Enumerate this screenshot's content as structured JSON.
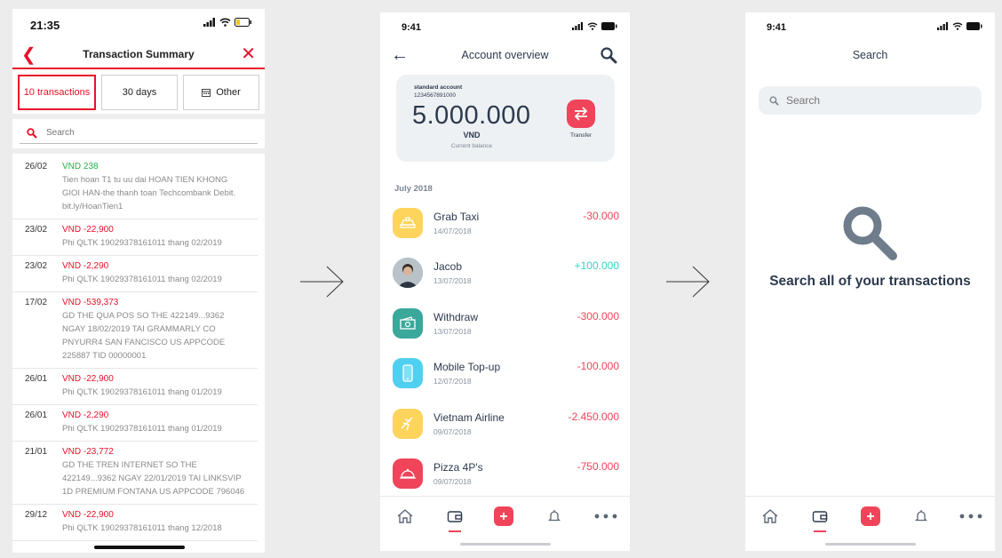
{
  "screen1": {
    "status_time": "21:35",
    "title": "Transaction Summary",
    "filters": [
      {
        "label": "10 transactions",
        "active": true
      },
      {
        "label": "30 days",
        "active": false
      },
      {
        "label": "Other",
        "active": false,
        "icon": "calendar-icon"
      }
    ],
    "search_placeholder": "Search",
    "transactions": [
      {
        "date": "26/02",
        "amount": "VND 238",
        "positive": true,
        "desc": [
          "Tien hoan T1 tu uu dai HOAN TIEN KHONG",
          "GIOI HAN-the thanh toan Techcombank Debit.",
          "bit.ly/HoanTien1"
        ]
      },
      {
        "date": "23/02",
        "amount": "VND -22,900",
        "positive": false,
        "desc": [
          "Phi QLTK 19029378161011 thang 02/2019"
        ]
      },
      {
        "date": "23/02",
        "amount": "VND -2,290",
        "positive": false,
        "desc": [
          "Phi QLTK 19029378161011 thang 02/2019"
        ]
      },
      {
        "date": "17/02",
        "amount": "VND -539,373",
        "positive": false,
        "desc": [
          "GD THE QUA POS SO THE 422149...9362",
          "NGAY 18/02/2019 TAI GRAMMARLY CO",
          "PNYURR4 SAN FANCISCO US APPCODE",
          "225887 TID 00000001"
        ]
      },
      {
        "date": "26/01",
        "amount": "VND -22,900",
        "positive": false,
        "desc": [
          "Phi QLTK 19029378161011 thang 01/2019"
        ]
      },
      {
        "date": "26/01",
        "amount": "VND -2,290",
        "positive": false,
        "desc": [
          "Phi QLTK 19029378161011 thang 01/2019"
        ]
      },
      {
        "date": "21/01",
        "amount": "VND -23,772",
        "positive": false,
        "desc": [
          "GD THE TREN INTERNET SO THE",
          "422149...9362 NGAY 22/01/2019 TAI LINKSVIP",
          "1D PREMIUM FONTANA US APPCODE 796046"
        ]
      },
      {
        "date": "29/12",
        "amount": "VND -22,900",
        "positive": false,
        "desc": [
          "Phi QLTK 19029378161011 thang 12/2018"
        ]
      }
    ]
  },
  "screen2": {
    "status_time": "9:41",
    "title": "Account overview",
    "card": {
      "label": "standard account",
      "account_number": "1234567891000",
      "balance": "5.000.000",
      "currency": "VND",
      "caption": "Current balance",
      "transfer_label": "Transfer"
    },
    "month": "July 2018",
    "transactions": [
      {
        "name": "Grab Taxi",
        "date": "14/07/2018",
        "value": "-30.000",
        "positive": false,
        "icon": "taxi-icon",
        "color": "#ffd45c"
      },
      {
        "name": "Jacob",
        "date": "13/07/2018",
        "value": "+100.000",
        "positive": true,
        "icon": "avatar",
        "color": "#7a8a96"
      },
      {
        "name": "Withdraw",
        "date": "13/07/2018",
        "value": "-300.000",
        "positive": false,
        "icon": "cash-icon",
        "color": "#3aa89a"
      },
      {
        "name": "Mobile Top-up",
        "date": "12/07/2018",
        "value": "-100.000",
        "positive": false,
        "icon": "phone-icon",
        "color": "#4fd0f0"
      },
      {
        "name": "Vietnam Airline",
        "date": "09/07/2018",
        "value": "-2.450.000",
        "positive": false,
        "icon": "plane-icon",
        "color": "#ffd45c"
      },
      {
        "name": "Pizza 4P's",
        "date": "09/07/2018",
        "value": "-750.000",
        "positive": false,
        "icon": "cloche-icon",
        "color": "#f0445a"
      }
    ]
  },
  "screen3": {
    "status_time": "9:41",
    "title": "Search",
    "search_placeholder": "Search",
    "empty_text": "Search all of your transactions"
  },
  "colors": {
    "brand_red": "#e8102a",
    "accent_pink": "#f0445a",
    "navy": "#2d3a4d",
    "teal_positive": "#2fd7c3"
  }
}
